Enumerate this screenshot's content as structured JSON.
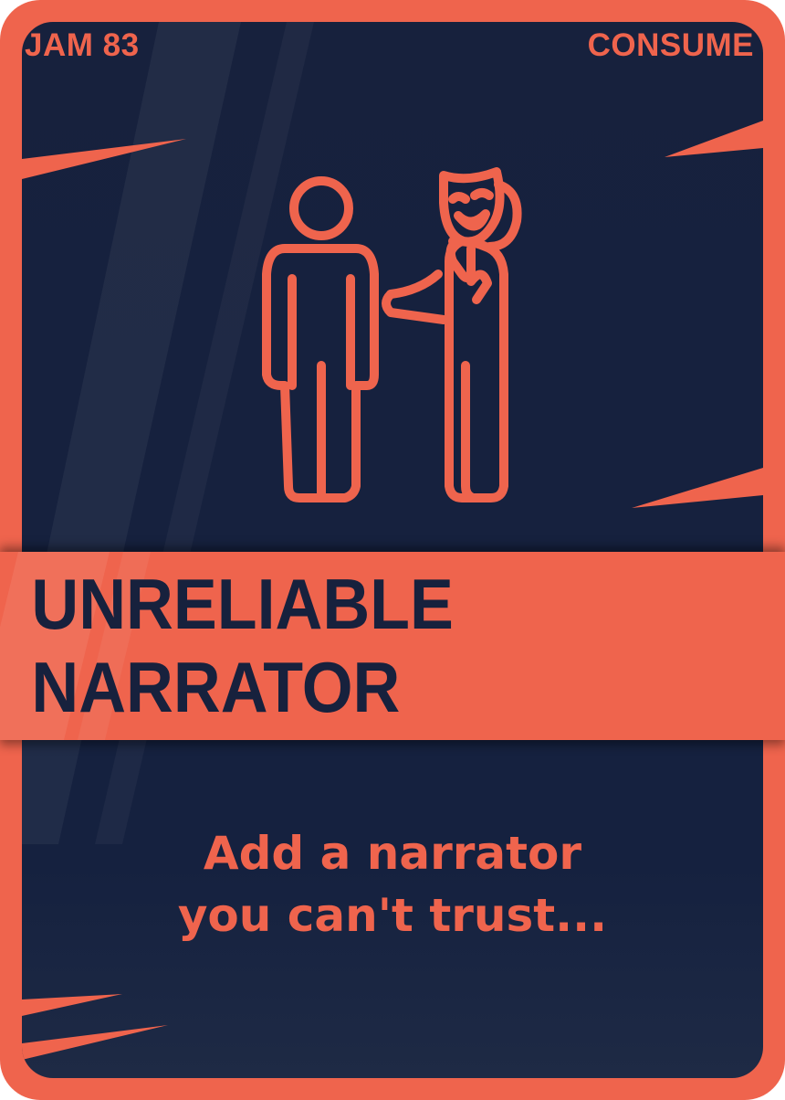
{
  "card": {
    "corner_left": "JAM 83",
    "corner_right": "CONSUME",
    "title": "UNRELIABLE NARRATOR",
    "description_lines": [
      "Add a narrator",
      "you can't trust..."
    ],
    "illustration_icon": "person-and-masked-narrator-icon"
  },
  "colors": {
    "accent": "#ef644d",
    "background": "#17213d",
    "title_text": "#17213d"
  }
}
